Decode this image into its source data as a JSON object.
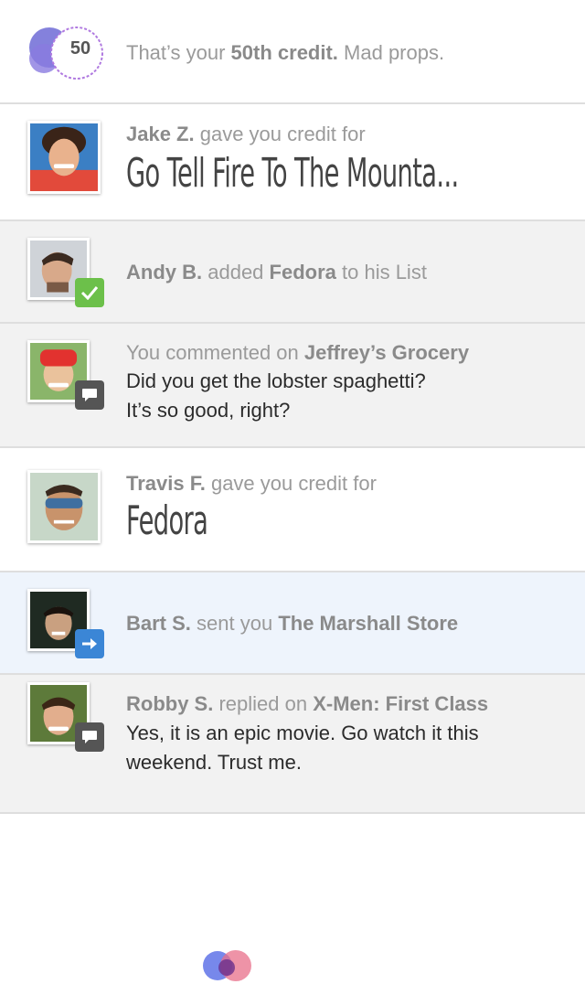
{
  "items": [
    {
      "type": "milestone",
      "badge_number": "50",
      "pre": "That’s your ",
      "bold": "50th credit.",
      "post": " Mad props."
    },
    {
      "type": "credit",
      "user": "Jake Z.",
      "action": " gave you credit for",
      "title": "Go Tell Fire To The Mounta..."
    },
    {
      "type": "list_add",
      "user": "Andy B.",
      "action": " added ",
      "target": "Fedora",
      "post": " to his List",
      "badge_icon": "checkmark-icon"
    },
    {
      "type": "comment",
      "pre": "You commented on ",
      "target": "Jeffrey’s Grocery",
      "lines": [
        "Did you get the lobster spaghetti?",
        "It’s so good, right?"
      ],
      "badge_icon": "comment-icon"
    },
    {
      "type": "credit",
      "user": "Travis F.",
      "action": " gave you credit for",
      "title": "Fedora"
    },
    {
      "type": "sent",
      "user": "Bart S.",
      "action": " sent you ",
      "target": "The Marshall Store",
      "badge_icon": "arrow-right-icon"
    },
    {
      "type": "reply",
      "user": "Robby S.",
      "action": " replied on ",
      "target": "X-Men: First Class",
      "lines": [
        "Yes, it is an epic movie. Go watch it this",
        "weekend. Trust me."
      ],
      "badge_icon": "comment-icon"
    }
  ],
  "colors": {
    "check_badge": "#6cc04a",
    "comment_badge": "#555555",
    "send_badge": "#3b86d6",
    "highlight_row": "#eef4fc"
  }
}
